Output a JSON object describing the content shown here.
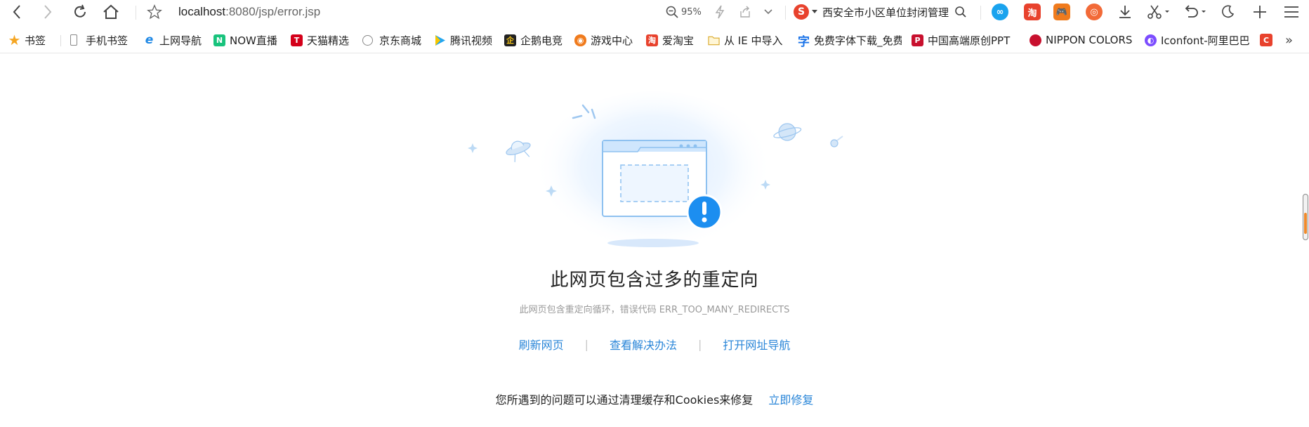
{
  "toolbar": {
    "url_host": "localhost",
    "url_path": ":8080/jsp/error.jsp",
    "zoom": "95%",
    "search_text": "西安全市小区单位封闭管理"
  },
  "bookmarks": {
    "items": [
      {
        "label": "书签",
        "icon": "star-icon",
        "color": "#f5a623"
      },
      {
        "label": "手机书签",
        "icon": "phone-icon",
        "color": "#888888"
      },
      {
        "label": "上网导航",
        "icon": "ie-icon",
        "color": "#1e88e5"
      },
      {
        "label": "NOW直播",
        "icon": "now-icon",
        "color": "#19c37d"
      },
      {
        "label": "天猫精选",
        "icon": "tmall-icon",
        "color": "#d4001a"
      },
      {
        "label": "京东商城",
        "icon": "globe-icon",
        "color": "#888888"
      },
      {
        "label": "腾讯视频",
        "icon": "tencent-video-icon",
        "color": "#23a6f0"
      },
      {
        "label": "企鹅电竞",
        "icon": "penguin-esports-icon",
        "color": "#222222"
      },
      {
        "label": "游戏中心",
        "icon": "gamepad-icon",
        "color": "#f07b1d"
      },
      {
        "label": "爱淘宝",
        "icon": "taobao-icon",
        "color": "#e8422d"
      },
      {
        "label": "从 IE 中导入",
        "icon": "folder-icon",
        "color": "#f2c744"
      },
      {
        "label": "免费字体下载_免费",
        "icon": "font-icon",
        "color": "#1a73e8"
      },
      {
        "label": "中国高端原创PPT",
        "icon": "ppt-brand-icon",
        "color": "#c8102e"
      },
      {
        "label": "NIPPON COLORS",
        "icon": "red-dot-icon",
        "color": "#c8102e"
      },
      {
        "label": "Iconfont-阿里巴巴",
        "icon": "iconfont-icon",
        "color": "#7c4dff"
      }
    ]
  },
  "error": {
    "title": "此网页包含过多的重定向",
    "subtitle": "此网页包含重定向循环，错误代码 ERR_TOO_MANY_REDIRECTS",
    "action_refresh": "刷新网页",
    "action_solution": "查看解决办法",
    "action_nav": "打开网址导航",
    "fix_text": "您所遇到的问题可以通过清理缓存和Cookies来修复",
    "fix_link": "立即修复"
  }
}
